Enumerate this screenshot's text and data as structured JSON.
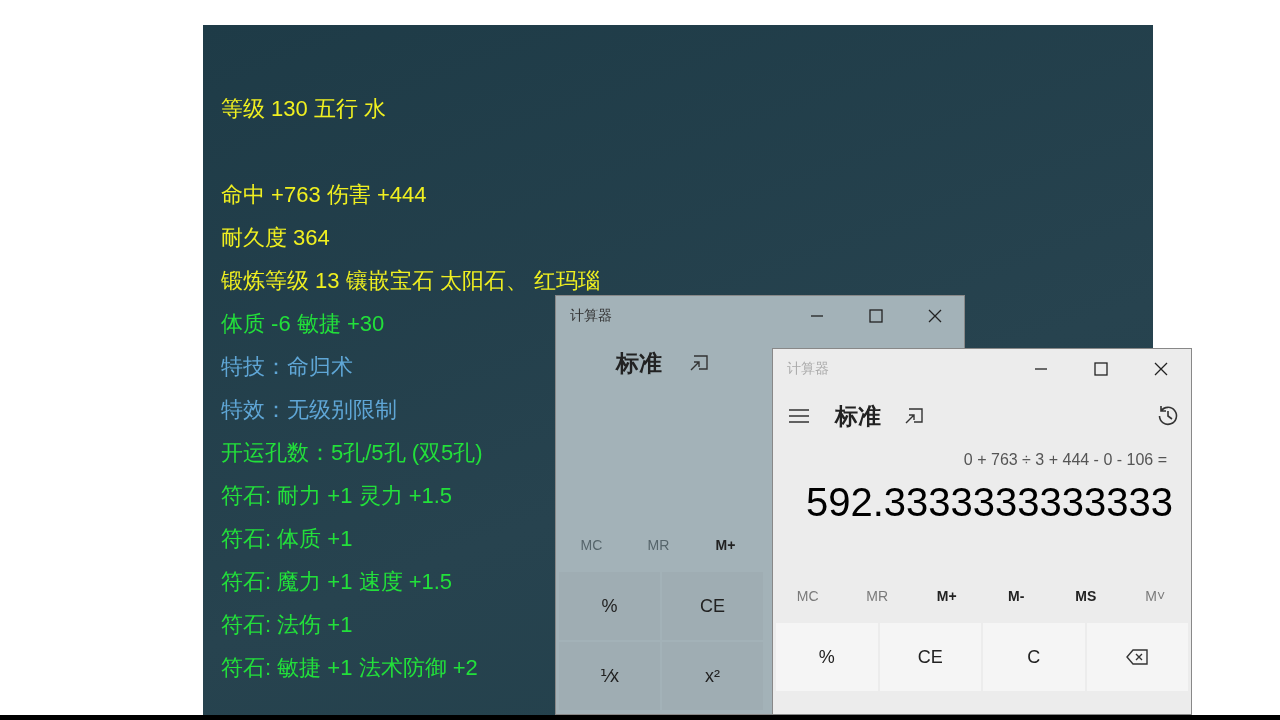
{
  "panel": {
    "blocks": [
      {
        "lines": [
          {
            "text": "等级 130 五行 水",
            "color": "#f0f020"
          }
        ]
      },
      {
        "lines": [
          {
            "text": "命中 +763 伤害 +444",
            "color": "#f0f020"
          },
          {
            "text": "耐久度 364",
            "color": "#f0f020"
          },
          {
            "text": "锻炼等级 13 镶嵌宝石 太阳石、 红玛瑙",
            "color": "#f0f020"
          },
          {
            "text": "体质 -6 敏捷 +30",
            "color": "#22e03a"
          },
          {
            "text": "特技：命归术",
            "color": "#5fa6d6"
          },
          {
            "text": "特效：无级别限制",
            "color": "#5fa6d6"
          },
          {
            "text": "开运孔数：5孔/5孔 (双5孔)",
            "color": "#22e03a"
          },
          {
            "text": "符石: 耐力 +1 灵力 +1.5",
            "color": "#22e03a"
          },
          {
            "text": "符石: 体质 +1",
            "color": "#22e03a"
          },
          {
            "text": "符石: 魔力 +1 速度 +1.5",
            "color": "#22e03a"
          },
          {
            "text": "符石: 法伤 +1",
            "color": "#22e03a"
          },
          {
            "text": "符石: 敏捷 +1 法术防御 +2",
            "color": "#22e03a"
          }
        ]
      }
    ]
  },
  "windows": [
    {
      "title": "计算器",
      "mode": "标准",
      "memory": [
        {
          "label": "MC",
          "disabled": true
        },
        {
          "label": "MR",
          "disabled": true
        },
        {
          "label": "M+",
          "disabled": false
        }
      ],
      "key_rows": [
        [
          {
            "kind": "text",
            "label": "%"
          },
          {
            "kind": "text",
            "label": "CE"
          }
        ],
        [
          {
            "kind": "text",
            "label": "⅟x"
          },
          {
            "kind": "text",
            "label": "x²"
          }
        ]
      ]
    },
    {
      "title": "计算器",
      "mode": "标准",
      "expression": "0 + 763 ÷ 3 + 444 - 0 - 106 =",
      "result": "592.3333333333333",
      "memory": [
        {
          "label": "MC",
          "disabled": true
        },
        {
          "label": "MR",
          "disabled": true
        },
        {
          "label": "M+",
          "disabled": false
        },
        {
          "label": "M-",
          "disabled": false
        },
        {
          "label": "MS",
          "disabled": false
        },
        {
          "label": "M˅",
          "disabled": true
        }
      ],
      "key_rows": [
        [
          {
            "kind": "text",
            "label": "%"
          },
          {
            "kind": "text",
            "label": "CE"
          },
          {
            "kind": "text",
            "label": "C"
          },
          {
            "kind": "backspace"
          }
        ]
      ]
    }
  ]
}
